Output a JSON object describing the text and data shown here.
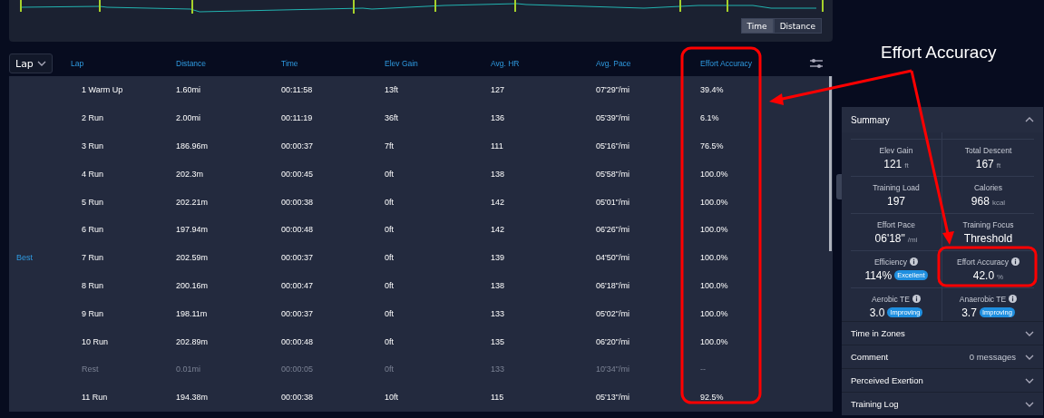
{
  "chart_panel": {
    "toggle": [
      {
        "label": "Time",
        "selected": true
      },
      {
        "label": "Distance",
        "selected": false
      }
    ]
  },
  "laps_table": {
    "group_by": "Lap",
    "columns": [
      "Lap",
      "Distance",
      "Time",
      "Elev Gain",
      "Avg. HR",
      "Avg. Pace",
      "Effort Accuracy"
    ],
    "rows": [
      {
        "kind": "lap",
        "cells": [
          "1 Warm Up",
          "1.60mi",
          "00:11:58",
          "13ft",
          "127",
          "07'29\"/mi",
          "39.4%"
        ]
      },
      {
        "kind": "lap",
        "cells": [
          "2 Run",
          "2.00mi",
          "00:11:19",
          "36ft",
          "136",
          "05'39\"/mi",
          "6.1%"
        ]
      },
      {
        "kind": "lap",
        "cells": [
          "3 Run",
          "186.96m",
          "00:00:37",
          "7ft",
          "111",
          "05'16\"/mi",
          "76.5%"
        ]
      },
      {
        "kind": "lap",
        "cells": [
          "4 Run",
          "202.3m",
          "00:00:45",
          "0ft",
          "138",
          "05'58\"/mi",
          "100.0%"
        ]
      },
      {
        "kind": "lap",
        "cells": [
          "5 Run",
          "202.21m",
          "00:00:38",
          "0ft",
          "142",
          "05'01\"/mi",
          "100.0%"
        ]
      },
      {
        "kind": "lap",
        "cells": [
          "6 Run",
          "197.94m",
          "00:00:48",
          "0ft",
          "142",
          "06'26\"/mi",
          "100.0%"
        ]
      },
      {
        "kind": "lap",
        "best_label": "Best",
        "cells": [
          "7 Run",
          "202.59m",
          "00:00:37",
          "0ft",
          "139",
          "04'50\"/mi",
          "100.0%"
        ]
      },
      {
        "kind": "lap",
        "cells": [
          "8 Run",
          "200.16m",
          "00:00:47",
          "0ft",
          "138",
          "06'18\"/mi",
          "100.0%"
        ]
      },
      {
        "kind": "lap",
        "cells": [
          "9 Run",
          "198.11m",
          "00:00:37",
          "0ft",
          "133",
          "05'02\"/mi",
          "100.0%"
        ]
      },
      {
        "kind": "lap",
        "cells": [
          "10 Run",
          "202.89m",
          "00:00:48",
          "0ft",
          "135",
          "06'20\"/mi",
          "100.0%"
        ]
      },
      {
        "kind": "rest",
        "cells": [
          "Rest",
          "0.01mi",
          "00:00:05",
          "0ft",
          "133",
          "10'34\"/mi",
          "--"
        ]
      },
      {
        "kind": "lap",
        "cells": [
          "11 Run",
          "194.38m",
          "00:00:38",
          "10ft",
          "115",
          "05'13\"/mi",
          "92.5%"
        ]
      }
    ]
  },
  "summary": {
    "title": "Summary",
    "expanded": true,
    "stats": [
      {
        "label": "Elev Gain",
        "value": "121",
        "unit": "ft"
      },
      {
        "label": "Total Descent",
        "value": "167",
        "unit": "ft"
      },
      {
        "label": "Training Load",
        "value": "197"
      },
      {
        "label": "Calories",
        "value": "968",
        "unit": "kcal"
      },
      {
        "label": "Effort Pace",
        "value": "06'18\"",
        "unit": "/mi"
      },
      {
        "label": "Training Focus",
        "value": "Threshold"
      },
      {
        "label": "Efficiency",
        "info": true,
        "value": "114%",
        "badge": "Excellent"
      },
      {
        "label": "Effort Accuracy",
        "info": true,
        "value": "42.0",
        "unit": "%"
      },
      {
        "label": "Aerobic TE",
        "info": true,
        "value": "3.0",
        "badge": "Improving"
      },
      {
        "label": "Anaerobic TE",
        "info": true,
        "value": "3.7",
        "badge": "Improving"
      }
    ]
  },
  "sections": [
    {
      "title": "Time in Zones",
      "expanded": false
    },
    {
      "title": "Comment",
      "detail": "0 messages",
      "expanded": false
    },
    {
      "title": "Perceived Exertion",
      "expanded": false
    },
    {
      "title": "Training Log",
      "expanded": false
    }
  ],
  "annotation": {
    "label": "Effort Accuracy"
  }
}
